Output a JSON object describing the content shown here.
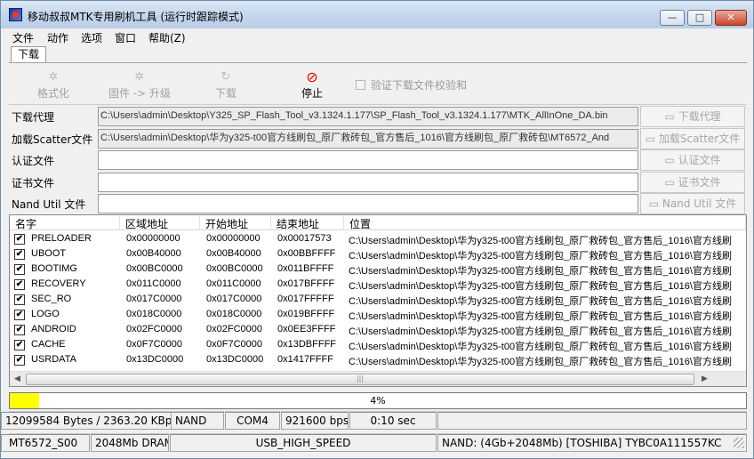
{
  "window": {
    "title": "移动叔叔MTK专用刷机工具 (运行时跟踪模式)",
    "buttons": {
      "minimize": "—",
      "maximize": "□",
      "close": "✕"
    }
  },
  "menu": [
    "文件",
    "动作",
    "选项",
    "窗口",
    "帮助(Z)"
  ],
  "tab": "下载",
  "toolbar": {
    "format": "格式化",
    "firmware_upgrade": "固件 -> 升级",
    "download": "下载",
    "stop": "停止",
    "verify_checksum": "验证下载文件校验和",
    "icons": {
      "format": "gear-icon",
      "firmware": "gear-icon",
      "download": "refresh-icon",
      "stop": "stop-icon"
    }
  },
  "fields": {
    "download_agent": {
      "label": "下载代理",
      "value": "C:\\Users\\admin\\Desktop\\Y325_SP_Flash_Tool_v3.1324.1.177\\SP_Flash_Tool_v3.1324.1.177\\MTK_AllInOne_DA.bin",
      "button": "下载代理"
    },
    "scatter": {
      "label": "加载Scatter文件",
      "value": "C:\\Users\\admin\\Desktop\\华为y325-t00官方线刷包_原厂救砖包_官方售后_1016\\官方线刷包_原厂救砖包\\MT6572_And",
      "button": "加载Scatter文件"
    },
    "auth": {
      "label": "认证文件",
      "value": "",
      "button": "认证文件"
    },
    "cert": {
      "label": "证书文件",
      "value": "",
      "button": "证书文件"
    },
    "nand_util": {
      "label": "Nand Util 文件",
      "value": "",
      "button": "Nand Util 文件"
    }
  },
  "table": {
    "headers": [
      "名字",
      "区域地址",
      "开始地址",
      "结束地址",
      "位置"
    ],
    "rows": [
      {
        "name": "PRELOADER",
        "region": "0x00000000",
        "start": "0x00000000",
        "end": "0x00017573",
        "location": "C:\\Users\\admin\\Desktop\\华为y325-t00官方线刷包_原厂救砖包_官方售后_1016\\官方线刷"
      },
      {
        "name": "UBOOT",
        "region": "0x00B40000",
        "start": "0x00B40000",
        "end": "0x00BBFFFF",
        "location": "C:\\Users\\admin\\Desktop\\华为y325-t00官方线刷包_原厂救砖包_官方售后_1016\\官方线刷"
      },
      {
        "name": "BOOTIMG",
        "region": "0x00BC0000",
        "start": "0x00BC0000",
        "end": "0x011BFFFF",
        "location": "C:\\Users\\admin\\Desktop\\华为y325-t00官方线刷包_原厂救砖包_官方售后_1016\\官方线刷"
      },
      {
        "name": "RECOVERY",
        "region": "0x011C0000",
        "start": "0x011C0000",
        "end": "0x017BFFFF",
        "location": "C:\\Users\\admin\\Desktop\\华为y325-t00官方线刷包_原厂救砖包_官方售后_1016\\官方线刷"
      },
      {
        "name": "SEC_RO",
        "region": "0x017C0000",
        "start": "0x017C0000",
        "end": "0x017FFFFF",
        "location": "C:\\Users\\admin\\Desktop\\华为y325-t00官方线刷包_原厂救砖包_官方售后_1016\\官方线刷"
      },
      {
        "name": "LOGO",
        "region": "0x018C0000",
        "start": "0x018C0000",
        "end": "0x019BFFFF",
        "location": "C:\\Users\\admin\\Desktop\\华为y325-t00官方线刷包_原厂救砖包_官方售后_1016\\官方线刷"
      },
      {
        "name": "ANDROID",
        "region": "0x02FC0000",
        "start": "0x02FC0000",
        "end": "0x0EE3FFFF",
        "location": "C:\\Users\\admin\\Desktop\\华为y325-t00官方线刷包_原厂救砖包_官方售后_1016\\官方线刷"
      },
      {
        "name": "CACHE",
        "region": "0x0F7C0000",
        "start": "0x0F7C0000",
        "end": "0x13DBFFFF",
        "location": "C:\\Users\\admin\\Desktop\\华为y325-t00官方线刷包_原厂救砖包_官方售后_1016\\官方线刷"
      },
      {
        "name": "USRDATA",
        "region": "0x13DC0000",
        "start": "0x13DC0000",
        "end": "0x1417FFFF",
        "location": "C:\\Users\\admin\\Desktop\\华为y325-t00官方线刷包_原厂救砖包_官方售后_1016\\官方线刷"
      }
    ],
    "checked_mark": "✔",
    "scroll_grip": "|||"
  },
  "progress": {
    "text": "4%",
    "value": 0.04,
    "color": "#ffff00"
  },
  "status1": {
    "bytes": "12099584 Bytes / 2363.20 KBp",
    "type": "NAND",
    "port": "COM4",
    "baud": "921600 bps",
    "time": "0:10 sec"
  },
  "status2": {
    "chip": "MT6572_S00",
    "dram": "2048Mb DRAM",
    "usb": "USB_HIGH_SPEED",
    "nand": "NAND: (4Gb+2048Mb) [TOSHIBA] TYBC0A111557KC"
  }
}
